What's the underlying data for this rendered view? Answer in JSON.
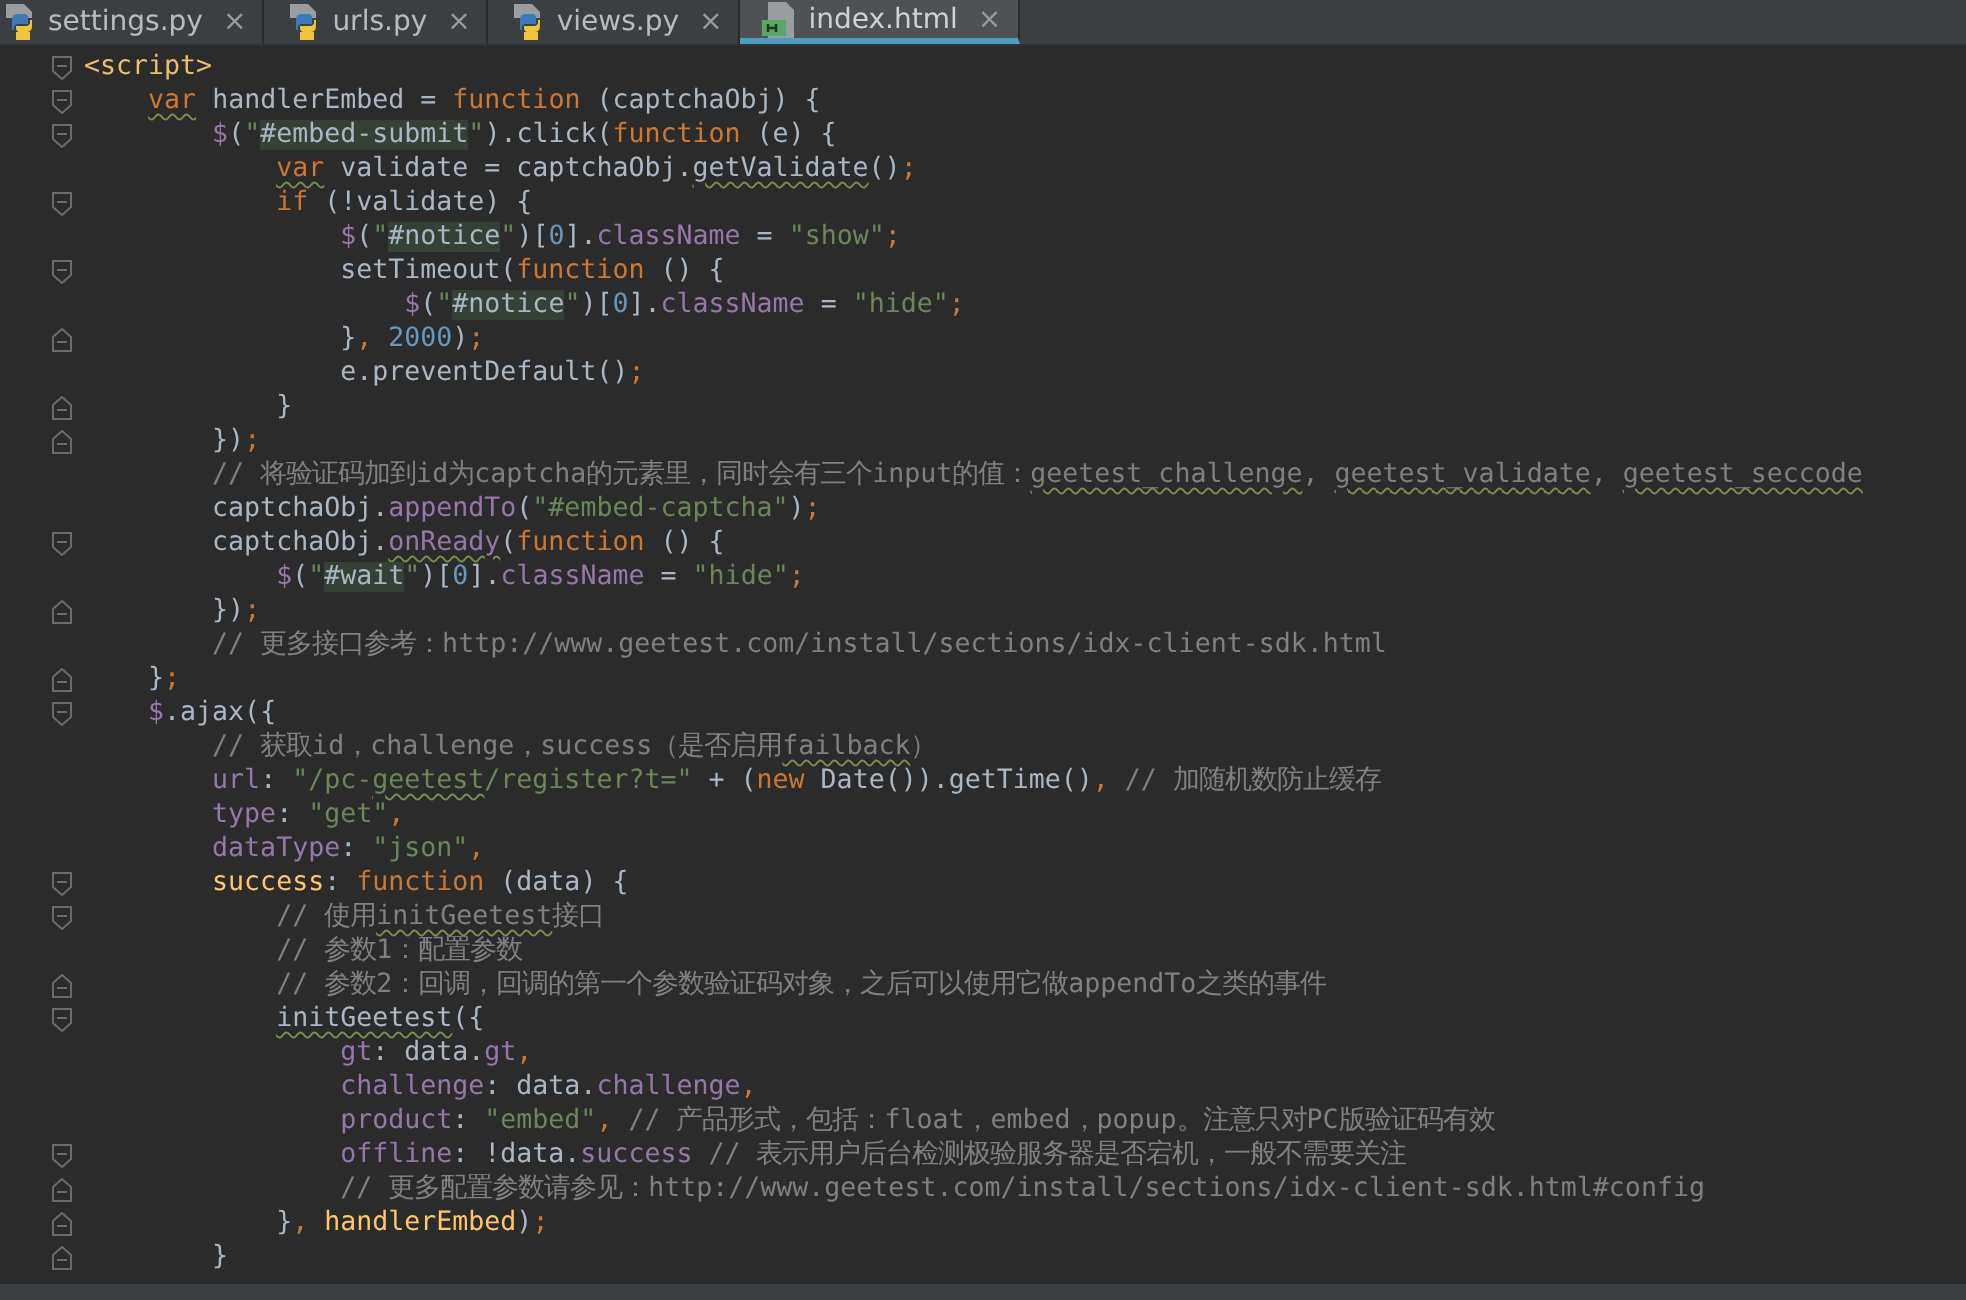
{
  "tabs": [
    {
      "label": "settings.py",
      "kind": "python",
      "close": "×",
      "selected": false
    },
    {
      "label": "urls.py",
      "kind": "python",
      "close": "×",
      "selected": false
    },
    {
      "label": "views.py",
      "kind": "python",
      "close": "×",
      "selected": false
    },
    {
      "label": "index.html",
      "kind": "html",
      "close": "×",
      "selected": true
    }
  ],
  "lines": [
    {
      "fold_start": true,
      "tokens": [
        {
          "kind": "tag",
          "text": "<script>"
        }
      ]
    },
    {
      "fold_start": true,
      "tokens": [
        {
          "kind": "kw",
          "text": "    var",
          "squiggle": true
        },
        {
          "kind": "plain",
          "text": " handlerEmbed = "
        },
        {
          "kind": "kw",
          "text": "function"
        },
        {
          "kind": "plain",
          "text": " (captchaObj) {"
        }
      ]
    },
    {
      "fold_start": true,
      "tokens": [
        {
          "kind": "prop",
          "text": "        $"
        },
        {
          "kind": "plain",
          "text": "("
        },
        {
          "kind": "str",
          "text": "\""
        },
        {
          "kind": "sel",
          "text": "#embed-submit"
        },
        {
          "kind": "str",
          "text": "\""
        },
        {
          "kind": "plain",
          "text": ").click("
        },
        {
          "kind": "kw",
          "text": "function"
        },
        {
          "kind": "plain",
          "text": " (e) {"
        }
      ]
    },
    {
      "tokens": [
        {
          "kind": "kw",
          "text": "            var",
          "squiggle": true
        },
        {
          "kind": "plain",
          "text": " validate = captchaObj."
        },
        {
          "kind": "plain",
          "text": "getValidate",
          "squiggle": true
        },
        {
          "kind": "plain",
          "text": "()"
        },
        {
          "kind": "kw",
          "text": ";"
        }
      ]
    },
    {
      "fold_start": true,
      "tokens": [
        {
          "kind": "kw",
          "text": "            if"
        },
        {
          "kind": "plain",
          "text": " (!validate) {"
        }
      ]
    },
    {
      "tokens": [
        {
          "kind": "prop",
          "text": "                $"
        },
        {
          "kind": "plain",
          "text": "("
        },
        {
          "kind": "str",
          "text": "\""
        },
        {
          "kind": "sel",
          "text": "#notice"
        },
        {
          "kind": "str",
          "text": "\""
        },
        {
          "kind": "plain",
          "text": ")["
        },
        {
          "kind": "num",
          "text": "0"
        },
        {
          "kind": "plain",
          "text": "]."
        },
        {
          "kind": "prop",
          "text": "className"
        },
        {
          "kind": "plain",
          "text": " = "
        },
        {
          "kind": "str",
          "text": "\"show\""
        },
        {
          "kind": "kw",
          "text": ";"
        }
      ]
    },
    {
      "fold_start": true,
      "tokens": [
        {
          "kind": "plain",
          "text": "                setTimeout("
        },
        {
          "kind": "kw",
          "text": "function"
        },
        {
          "kind": "plain",
          "text": " () {"
        }
      ]
    },
    {
      "tokens": [
        {
          "kind": "prop",
          "text": "                    $"
        },
        {
          "kind": "plain",
          "text": "("
        },
        {
          "kind": "str",
          "text": "\""
        },
        {
          "kind": "sel",
          "text": "#notice"
        },
        {
          "kind": "str",
          "text": "\""
        },
        {
          "kind": "plain",
          "text": ")["
        },
        {
          "kind": "num",
          "text": "0"
        },
        {
          "kind": "plain",
          "text": "]."
        },
        {
          "kind": "prop",
          "text": "className"
        },
        {
          "kind": "plain",
          "text": " = "
        },
        {
          "kind": "str",
          "text": "\"hide\""
        },
        {
          "kind": "kw",
          "text": ";"
        }
      ]
    },
    {
      "fold_end": true,
      "tokens": [
        {
          "kind": "plain",
          "text": "                }"
        },
        {
          "kind": "kw",
          "text": ", "
        },
        {
          "kind": "num",
          "text": "2000"
        },
        {
          "kind": "plain",
          "text": ")"
        },
        {
          "kind": "kw",
          "text": ";"
        }
      ]
    },
    {
      "tokens": [
        {
          "kind": "plain",
          "text": "                e.preventDefault()"
        },
        {
          "kind": "kw",
          "text": ";"
        }
      ]
    },
    {
      "fold_end": true,
      "tokens": [
        {
          "kind": "plain",
          "text": "            }"
        }
      ]
    },
    {
      "fold_end": true,
      "tokens": [
        {
          "kind": "plain",
          "text": "        })"
        },
        {
          "kind": "kw",
          "text": ";"
        }
      ]
    },
    {
      "tokens": [
        {
          "kind": "cm",
          "text": "        // 将验证码加到id为captcha的元素里，同时会有三个input的值："
        },
        {
          "kind": "cm",
          "text": "geetest_challenge",
          "squiggle": true
        },
        {
          "kind": "cm",
          "text": ", "
        },
        {
          "kind": "cm",
          "text": "geetest_validate",
          "squiggle": true
        },
        {
          "kind": "cm",
          "text": ", "
        },
        {
          "kind": "cm",
          "text": "geetest_seccode",
          "squiggle": true
        }
      ]
    },
    {
      "tokens": [
        {
          "kind": "plain",
          "text": "        captchaObj."
        },
        {
          "kind": "prop",
          "text": "appendTo"
        },
        {
          "kind": "plain",
          "text": "("
        },
        {
          "kind": "str",
          "text": "\"#embed-captcha\""
        },
        {
          "kind": "plain",
          "text": ")"
        },
        {
          "kind": "kw",
          "text": ";"
        }
      ]
    },
    {
      "fold_start": true,
      "tokens": [
        {
          "kind": "plain",
          "text": "        captchaObj."
        },
        {
          "kind": "prop",
          "text": "onReady",
          "squiggle": true
        },
        {
          "kind": "plain",
          "text": "("
        },
        {
          "kind": "kw",
          "text": "function"
        },
        {
          "kind": "plain",
          "text": " () {"
        }
      ]
    },
    {
      "tokens": [
        {
          "kind": "prop",
          "text": "            $"
        },
        {
          "kind": "plain",
          "text": "("
        },
        {
          "kind": "str",
          "text": "\""
        },
        {
          "kind": "sel",
          "text": "#wait"
        },
        {
          "kind": "str",
          "text": "\""
        },
        {
          "kind": "plain",
          "text": ")["
        },
        {
          "kind": "num",
          "text": "0"
        },
        {
          "kind": "plain",
          "text": "]."
        },
        {
          "kind": "prop",
          "text": "className"
        },
        {
          "kind": "plain",
          "text": " = "
        },
        {
          "kind": "str",
          "text": "\"hide\""
        },
        {
          "kind": "kw",
          "text": ";"
        }
      ]
    },
    {
      "fold_end": true,
      "tokens": [
        {
          "kind": "plain",
          "text": "        })"
        },
        {
          "kind": "kw",
          "text": ";"
        }
      ]
    },
    {
      "tokens": [
        {
          "kind": "cm",
          "text": "        // 更多接口参考：http://www.geetest.com/install/sections/idx-client-sdk.html"
        }
      ]
    },
    {
      "fold_end": true,
      "tokens": [
        {
          "kind": "plain",
          "text": "    }"
        },
        {
          "kind": "kw",
          "text": ";"
        }
      ]
    },
    {
      "fold_start": true,
      "tokens": [
        {
          "kind": "prop",
          "text": "    $"
        },
        {
          "kind": "plain",
          "text": ".ajax({"
        }
      ]
    },
    {
      "tokens": [
        {
          "kind": "cm",
          "text": "        // 获取id，challenge，success（是否启用"
        },
        {
          "kind": "cm",
          "text": "failback",
          "squiggle": true
        },
        {
          "kind": "cm",
          "text": "）"
        }
      ]
    },
    {
      "tokens": [
        {
          "kind": "prop",
          "text": "        url"
        },
        {
          "kind": "plain",
          "text": ": "
        },
        {
          "kind": "str",
          "text": "\"/pc-"
        },
        {
          "kind": "str",
          "text": "geetest",
          "squiggle": true
        },
        {
          "kind": "str",
          "text": "/register?t=\""
        },
        {
          "kind": "plain",
          "text": " + ("
        },
        {
          "kind": "kw",
          "text": "new"
        },
        {
          "kind": "plain",
          "text": " Date()).getTime()"
        },
        {
          "kind": "kw",
          "text": ", "
        },
        {
          "kind": "cm",
          "text": "// 加随机数防止缓存"
        }
      ]
    },
    {
      "tokens": [
        {
          "kind": "prop",
          "text": "        type"
        },
        {
          "kind": "plain",
          "text": ": "
        },
        {
          "kind": "str",
          "text": "\"get\""
        },
        {
          "kind": "kw",
          "text": ","
        }
      ]
    },
    {
      "tokens": [
        {
          "kind": "prop",
          "text": "        dataType"
        },
        {
          "kind": "plain",
          "text": ": "
        },
        {
          "kind": "str",
          "text": "\"json\""
        },
        {
          "kind": "kw",
          "text": ","
        }
      ]
    },
    {
      "fold_start": true,
      "tokens": [
        {
          "kind": "fn",
          "text": "        success"
        },
        {
          "kind": "plain",
          "text": ": "
        },
        {
          "kind": "kw",
          "text": "function"
        },
        {
          "kind": "plain",
          "text": " (data) {"
        }
      ]
    },
    {
      "fold_start": true,
      "tokens": [
        {
          "kind": "cm",
          "text": "            // 使用"
        },
        {
          "kind": "cm",
          "text": "initGeetest",
          "squiggle": true
        },
        {
          "kind": "cm",
          "text": "接口"
        }
      ]
    },
    {
      "tokens": [
        {
          "kind": "cm",
          "text": "            // 参数1：配置参数"
        }
      ]
    },
    {
      "fold_end": true,
      "tokens": [
        {
          "kind": "cm",
          "text": "            // 参数2：回调，回调的第一个参数验证码对象，之后可以使用它做appendTo之类的事件"
        }
      ]
    },
    {
      "fold_start": true,
      "tokens": [
        {
          "kind": "plain",
          "text": "            initGeetest",
          "squiggle": true
        },
        {
          "kind": "plain",
          "text": "({"
        }
      ]
    },
    {
      "tokens": [
        {
          "kind": "prop",
          "text": "                gt"
        },
        {
          "kind": "plain",
          "text": ": data."
        },
        {
          "kind": "prop",
          "text": "gt"
        },
        {
          "kind": "kw",
          "text": ","
        }
      ]
    },
    {
      "tokens": [
        {
          "kind": "prop",
          "text": "                challenge"
        },
        {
          "kind": "plain",
          "text": ": data."
        },
        {
          "kind": "prop",
          "text": "challenge"
        },
        {
          "kind": "kw",
          "text": ","
        }
      ]
    },
    {
      "tokens": [
        {
          "kind": "prop",
          "text": "                product"
        },
        {
          "kind": "plain",
          "text": ": "
        },
        {
          "kind": "str",
          "text": "\"embed\""
        },
        {
          "kind": "kw",
          "text": ", "
        },
        {
          "kind": "cm",
          "text": "// 产品形式，包括：float，embed，popup。注意只对PC版验证码有效"
        }
      ]
    },
    {
      "fold_start": true,
      "tokens": [
        {
          "kind": "prop",
          "text": "                offline"
        },
        {
          "kind": "plain",
          "text": ": !data."
        },
        {
          "kind": "prop",
          "text": "success"
        },
        {
          "kind": "cm",
          "text": " // 表示用户后台检测极验服务器是否宕机，一般不需要关注"
        }
      ]
    },
    {
      "fold_end": true,
      "tokens": [
        {
          "kind": "cm",
          "text": "                // 更多配置参数请参见：http://www.geetest.com/install/sections/idx-client-sdk.html#config"
        }
      ]
    },
    {
      "fold_end": true,
      "tokens": [
        {
          "kind": "plain",
          "text": "            }"
        },
        {
          "kind": "kw",
          "text": ", "
        },
        {
          "kind": "fn",
          "text": "handlerEmbed"
        },
        {
          "kind": "plain",
          "text": ")"
        },
        {
          "kind": "kw",
          "text": ";"
        }
      ]
    },
    {
      "fold_end": true,
      "tokens": [
        {
          "kind": "plain",
          "text": "        }"
        }
      ]
    }
  ]
}
